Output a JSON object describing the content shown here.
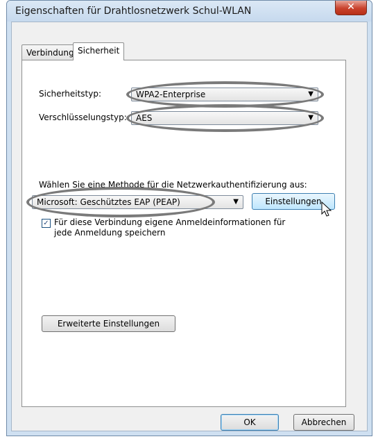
{
  "window": {
    "title": "Eigenschaften für Drahtlosnetzwerk Schul-WLAN",
    "close_symbol": "✕"
  },
  "tabs": [
    {
      "label": "Verbindung",
      "active": false
    },
    {
      "label": "Sicherheit",
      "active": true
    }
  ],
  "security": {
    "type_label": "Sicherheitstyp:",
    "type_value": "WPA2-Enterprise",
    "encryption_label": "Verschlüsselungstyp:",
    "encryption_value": "AES"
  },
  "auth": {
    "prompt": "Wählen Sie eine Methode für die Netzwerkauthentifizierung aus:",
    "method_value": "Microsoft: Geschütztes EAP (PEAP)",
    "settings_button": "Einstellungen",
    "remember_checked": true,
    "remember_line1": "Für diese Verbindung eigene Anmeldeinformationen für",
    "remember_line2": "jede Anmeldung speichern"
  },
  "advanced_button": "Erweiterte Einstellungen",
  "footer": {
    "ok": "OK",
    "cancel": "Abbrechen"
  },
  "icons": {
    "dropdown_arrow": "▼",
    "check": "✓"
  }
}
